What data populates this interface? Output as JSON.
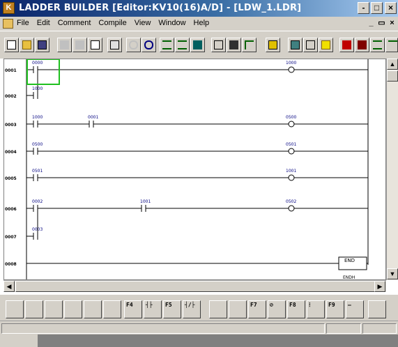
{
  "window": {
    "title": "LADDER BUILDER   [Editor:KV10(16)A/D]  - [LDW_1.LDR]",
    "minimize_glyph": "-",
    "restore_glyph": "□",
    "close_glyph": "×"
  },
  "menubar": {
    "items": [
      "File",
      "Edit",
      "Comment",
      "Compile",
      "View",
      "Window",
      "Help"
    ],
    "mdi_minimize": "_",
    "mdi_restore": "▭",
    "mdi_close": "×"
  },
  "toolbar": {
    "buttons": [
      "new-icon",
      "open-icon",
      "save-icon",
      "cut-icon",
      "copy-icon",
      "paste-icon",
      "print-icon",
      "undo-icon",
      "redo-icon",
      "insert-line-icon",
      "insert-column-icon",
      "find-icon",
      "monitor-icon",
      "search-icon",
      "replace-icon",
      "compile-icon",
      "rung-list-icon",
      "device-icon",
      "help-icon",
      "online-edit-icon",
      "transfer-icon",
      "verify-icon",
      "comment-icon",
      "toolbar-extra-icon"
    ]
  },
  "ladder": {
    "rungs": [
      {
        "line": "0001",
        "contacts": [
          "0000"
        ],
        "coil": "1000",
        "selected": true
      },
      {
        "line": "0002",
        "contacts": [
          "1000"
        ],
        "coil": null
      },
      {
        "line": "0003",
        "contacts": [
          "1000",
          "0001"
        ],
        "coil": "0500"
      },
      {
        "line": "0004",
        "contacts": [
          "0500"
        ],
        "coil": "0501"
      },
      {
        "line": "0005",
        "contacts": [
          "0501"
        ],
        "coil": "1001"
      },
      {
        "line": "0006",
        "contacts": [
          "0002",
          "1001"
        ],
        "coil": "0502"
      },
      {
        "line": "0007",
        "contacts": [
          "0003"
        ],
        "coil": null
      },
      {
        "line": "0008",
        "contacts": [],
        "coil": null,
        "instruction": "END"
      }
    ],
    "end_label": "END",
    "endh_label": "ENDH"
  },
  "function_keys": [
    "F4",
    "F5",
    "F7",
    "F8",
    "F9"
  ],
  "scroll": {
    "up": "▲",
    "down": "▼",
    "left": "◀",
    "right": "▶"
  }
}
